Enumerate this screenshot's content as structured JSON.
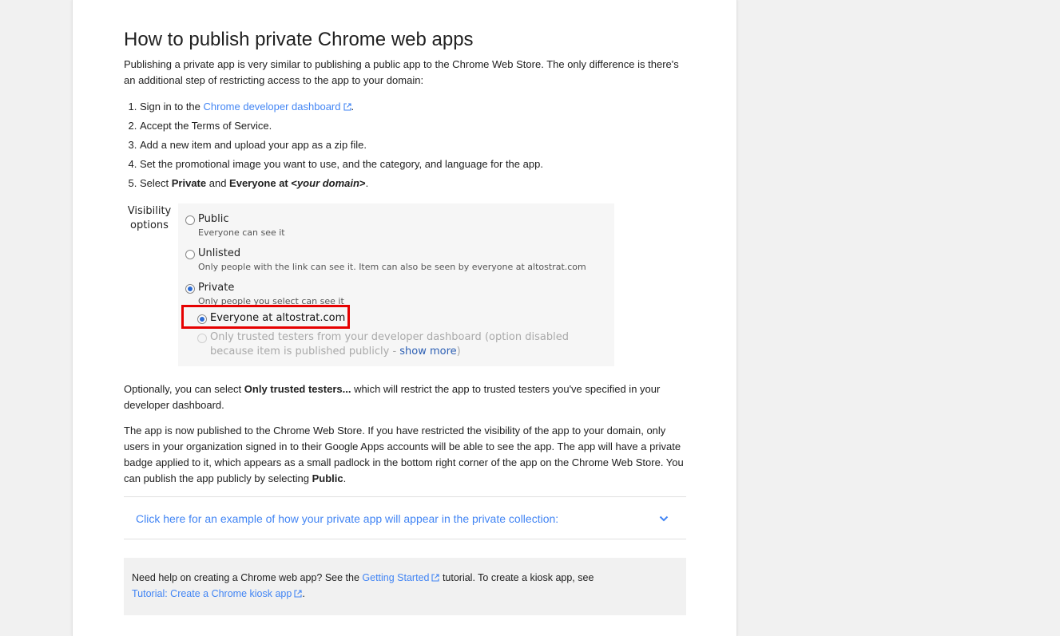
{
  "article": {
    "title": "How to publish private Chrome web apps",
    "intro": "Publishing a private app is very similar to publishing a public app to the Chrome Web Store. The only difference is there's an additional step of restricting access to the app to your domain:",
    "steps": {
      "s1_prefix": "Sign in to the ",
      "s1_link": "Chrome developer dashboard",
      "s1_suffix": ".",
      "s2": "Accept the Terms of Service.",
      "s3": "Add a new item and upload your app as a zip file.",
      "s4": "Set the promotional image you want to use, and the category, and language for the app.",
      "s5_prefix": "Select ",
      "s5_private": "Private",
      "s5_and": " and ",
      "s5_everyone": "Everyone at <",
      "s5_domain": "your domain",
      "s5_close": ">",
      "s5_suffix": "."
    },
    "optional_prefix": "Optionally, you can select ",
    "optional_bold": "Only trusted testers...",
    "optional_suffix": " which will restrict the app to trusted testers you've specified in your developer dashboard.",
    "published_text": "The app is now published to the Chrome Web Store. If you have restricted the visibility of the app to your domain, only users in your organization signed in to their Google Apps accounts will be able to see the app. The app will have a private badge applied to it, which appears as a small padlock in the bottom right corner of the app on the Chrome Web Store. You can publish the app publicly by selecting ",
    "published_bold": "Public",
    "published_end": ".",
    "accordion_label": "Click here for an example of how your private app will appear in the private collection:",
    "note": {
      "prefix": "Need help on creating a Chrome web app? See the ",
      "link1": "Getting Started",
      "middle": " tutorial. To create a kiosk app, see",
      "link2": "Tutorial: Create a Chrome kiosk app",
      "suffix": "."
    }
  },
  "visibility": {
    "label_line1": "Visibility",
    "label_line2": "options",
    "public_title": "Public",
    "public_desc": "Everyone can see it",
    "unlisted_title": "Unlisted",
    "unlisted_desc": "Only people with the link can see it. Item can also be seen by everyone at altostrat.com",
    "private_title": "Private",
    "private_desc": "Only people you select can see it",
    "everyone_title": "Everyone at altostrat.com",
    "trusted_text": "Only trusted testers from your developer dashboard (option disabled because item is published publicly - ",
    "show_more": "show more",
    "trusted_end": ")",
    "selected": "Private",
    "sub_selected": "Everyone at altostrat.com"
  },
  "colors": {
    "link": "#4285f4",
    "highlight": "#e60000"
  },
  "icons": {
    "external_link": "external-link-icon",
    "accordion": "chevron-down-icon"
  }
}
